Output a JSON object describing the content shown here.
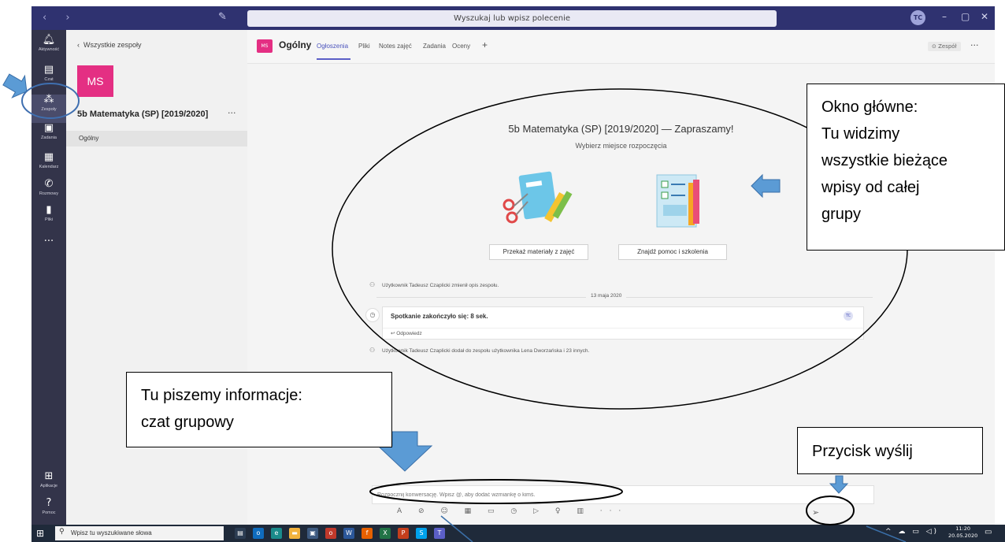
{
  "window": {
    "nav_arrows": "‹ ›",
    "search_placeholder": "Wyszukaj lub wpisz polecenie",
    "avatar_initials": "TC",
    "minimize": "–",
    "maximize": "▢",
    "close": "✕"
  },
  "rail": {
    "items": [
      {
        "label": "Aktywność",
        "icon": "bell-icon"
      },
      {
        "label": "Czat",
        "icon": "chat-icon"
      },
      {
        "label": "Zespoły",
        "icon": "teams-icon"
      },
      {
        "label": "Zadania",
        "icon": "assignments-icon"
      },
      {
        "label": "Kalendarz",
        "icon": "calendar-icon"
      },
      {
        "label": "Rozmowy",
        "icon": "phone-icon"
      },
      {
        "label": "Pliki",
        "icon": "file-icon"
      }
    ],
    "more": "...",
    "apps_label": "Aplikacje",
    "help_label": "Pomoc"
  },
  "left_panel": {
    "back_label": "Wszystkie zespoły",
    "team_initials": "MS",
    "team_name": "5b Matematyka (SP) [2019/2020]",
    "team_more": "···",
    "channel": "Ogólny"
  },
  "header": {
    "badge": "MS",
    "channel_title": "Ogólny",
    "tabs": [
      "Ogłoszenia",
      "Pliki",
      "Notes zajęć",
      "Zadania",
      "Oceny",
      "+"
    ],
    "team_button": "⊙ Zespół",
    "more": "···"
  },
  "welcome": {
    "title": "5b Matematyka (SP) [2019/2020] — Zapraszamy!",
    "subtitle": "Wybierz miejsce rozpoczęcia",
    "button_left": "Przekaż materiały z zajęć",
    "button_right": "Znajdź pomoc i szkolenia"
  },
  "activity": {
    "item1": "Użytkownik Tadeusz Czaplicki zmienił opis zespołu.",
    "date": "13 maja 2020",
    "meeting_title": "Spotkanie zakończyło się: 8 sek.",
    "meeting_avatar": "TC",
    "reply": "↩ Odpowiedz",
    "item2": "Użytkownik Tadeusz Czaplicki dodał do zespołu użytkownika Lena Dworzańska i 23 innych."
  },
  "compose": {
    "placeholder": "Rozpocznij konwersację. Wpisz @, aby dodać wzmiankę o kimś.",
    "toolbar": "A ⊘ ☺ ▦ ▭ ◷ ▷ ♀ ▥ ···",
    "send": "➢"
  },
  "taskbar": {
    "search_placeholder": "Wpisz tu wyszukiwane słowa",
    "time": "11:20",
    "date": "20.05.2020",
    "tray": "^ ☁ ▭ ◁)"
  },
  "annotations": {
    "main_window": [
      "Okno główne:",
      "Tu widzimy",
      "wszystkie bieżące",
      "wpisy od całej",
      "grupy"
    ],
    "chat": [
      "Tu piszemy informacje:",
      "czat grupowy"
    ],
    "send_button": "Przycisk wyślij"
  },
  "colors": {
    "titlebar": "#2f3270",
    "rail": "#33344a",
    "accent": "#5b5fc7",
    "team_tile": "#e42f83",
    "annotation_arrow": "#5b9bd5"
  }
}
